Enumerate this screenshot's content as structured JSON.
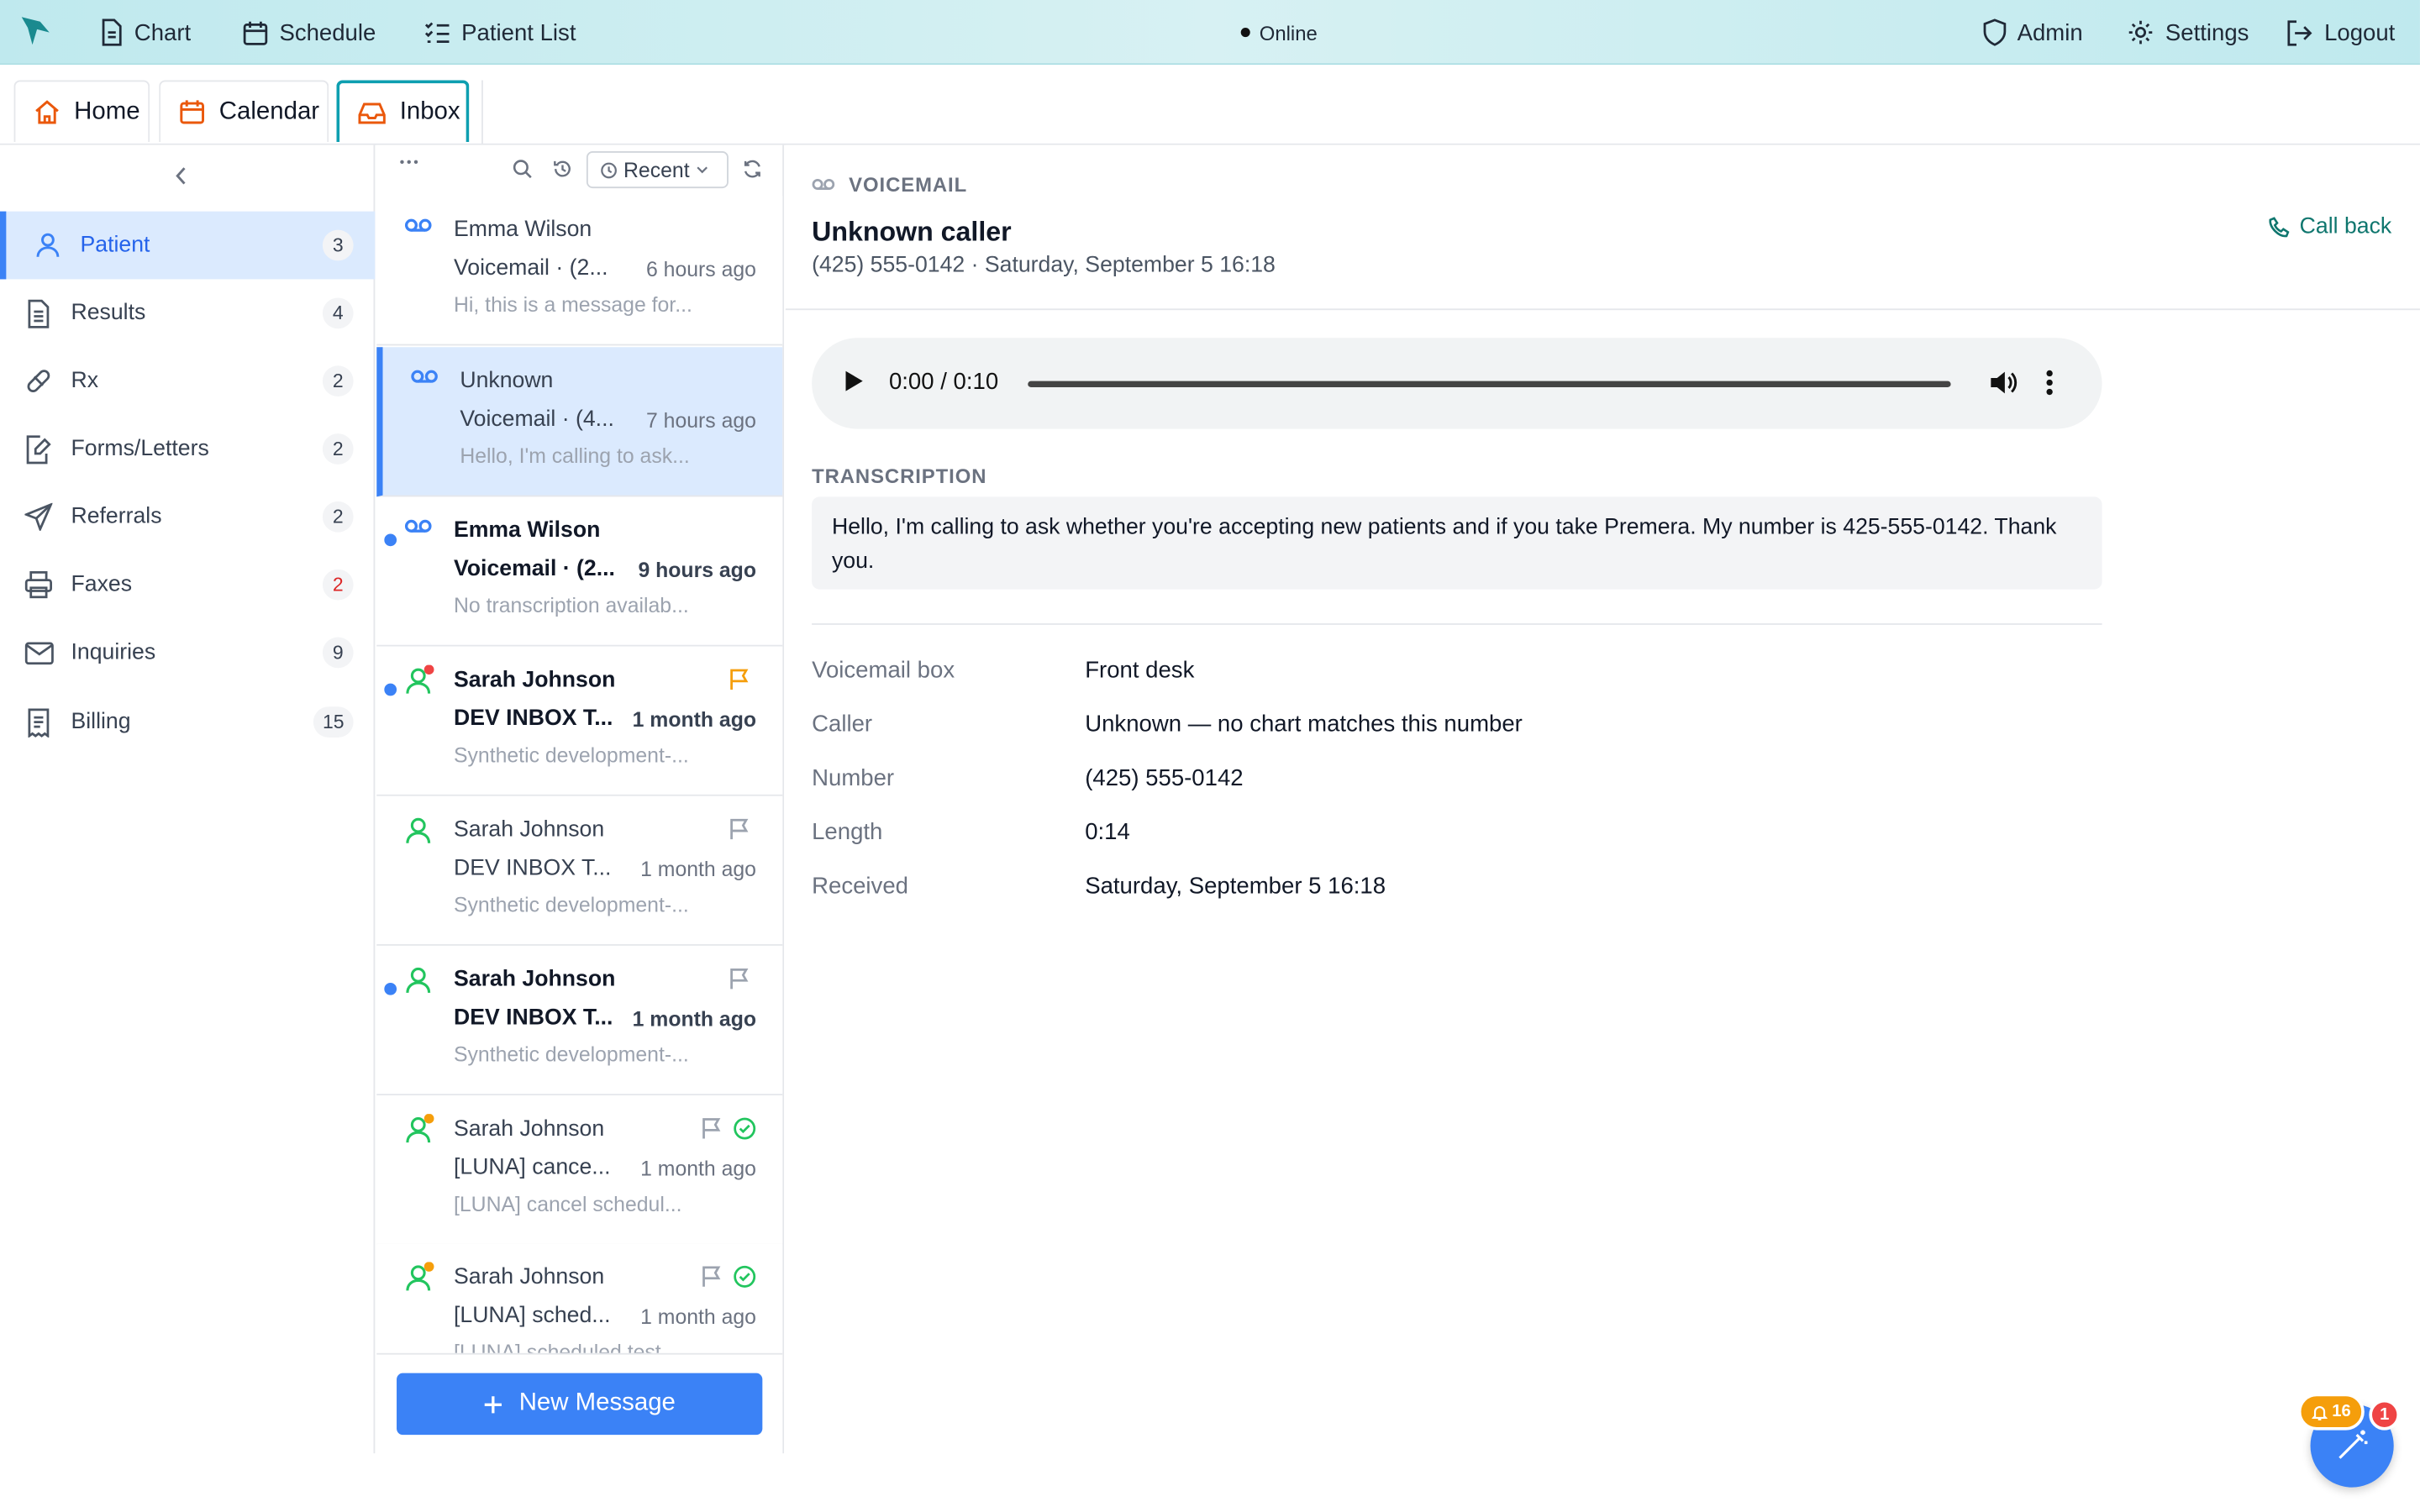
{
  "topnav": {
    "chart": "Chart",
    "schedule": "Schedule",
    "patient_list": "Patient List",
    "status": "Online",
    "admin": "Admin",
    "settings": "Settings",
    "logout": "Logout"
  },
  "tabs": [
    {
      "label": "Home",
      "icon": "home-icon"
    },
    {
      "label": "Calendar",
      "icon": "calendar-icon"
    },
    {
      "label": "Inbox",
      "icon": "inbox-icon",
      "active": true
    }
  ],
  "sidebar": {
    "items": [
      {
        "label": "Patient",
        "count": "3",
        "icon": "user-icon",
        "active": true
      },
      {
        "label": "Results",
        "count": "4",
        "icon": "document-icon"
      },
      {
        "label": "Rx",
        "count": "2",
        "icon": "pill-icon"
      },
      {
        "label": "Forms/Letters",
        "count": "2",
        "icon": "form-icon"
      },
      {
        "label": "Referrals",
        "count": "2",
        "icon": "send-icon"
      },
      {
        "label": "Faxes",
        "count": "2",
        "icon": "printer-icon",
        "alert": true
      },
      {
        "label": "Inquiries",
        "count": "9",
        "icon": "mail-icon"
      },
      {
        "label": "Billing",
        "count": "15",
        "icon": "receipt-icon"
      }
    ]
  },
  "list": {
    "filter_label": "Recent",
    "new_message": "New Message",
    "messages": [
      {
        "name": "Emma Wilson",
        "subject": "Voicemail · (2...",
        "time": "6 hours ago",
        "preview": "Hi, this is a message for...",
        "type": "voicemail",
        "unread": false
      },
      {
        "name": "Unknown",
        "subject": "Voicemail · (4...",
        "time": "7 hours ago",
        "preview": "Hello, I'm calling to ask...",
        "type": "voicemail",
        "unread": false,
        "selected": true
      },
      {
        "name": "Emma Wilson",
        "subject": "Voicemail · (2...",
        "time": "9 hours ago",
        "preview": "No transcription availab...",
        "type": "voicemail",
        "unread": true
      },
      {
        "name": "Sarah Johnson",
        "subject": "DEV INBOX T...",
        "time": "1 month ago",
        "preview": "Synthetic development-...",
        "type": "patient",
        "unread": true,
        "flag": "orange",
        "status_dot": "red"
      },
      {
        "name": "Sarah Johnson",
        "subject": "DEV INBOX T...",
        "time": "1 month ago",
        "preview": "Synthetic development-...",
        "type": "patient",
        "unread": false,
        "flag": "gray"
      },
      {
        "name": "Sarah Johnson",
        "subject": "DEV INBOX T...",
        "time": "1 month ago",
        "preview": "Synthetic development-...",
        "type": "patient",
        "unread": true,
        "flag": "gray"
      },
      {
        "name": "Sarah Johnson",
        "subject": "[LUNA] cance...",
        "time": "1 month ago",
        "preview": "[LUNA] cancel schedul...",
        "type": "patient",
        "unread": false,
        "flag": "gray",
        "done": true,
        "status_dot": "amber"
      },
      {
        "name": "Sarah Johnson",
        "subject": "[LUNA] sched...",
        "time": "1 month ago",
        "preview": "[LUNA] scheduled test...",
        "type": "patient",
        "unread": false,
        "flag": "gray",
        "done": true,
        "status_dot": "amber"
      }
    ]
  },
  "detail": {
    "kind": "VOICEMAIL",
    "caller": "Unknown caller",
    "subtitle": "(425) 555-0142 · Saturday, September 5 16:18",
    "call_back": "Call back",
    "player_time": "0:00 / 0:10",
    "transcription_label": "TRANSCRIPTION",
    "transcription": "Hello, I'm calling to ask whether you're accepting new patients and if you take Premera. My number is 425-555-0142. Thank you.",
    "fields": [
      {
        "key": "Voicemail box",
        "value": "Front desk"
      },
      {
        "key": "Caller",
        "value": "Unknown — no chart matches this number"
      },
      {
        "key": "Number",
        "value": "(425) 555-0142"
      },
      {
        "key": "Length",
        "value": "0:14"
      },
      {
        "key": "Received",
        "value": "Saturday, September 5 16:18"
      }
    ]
  },
  "widget": {
    "notifications": "16",
    "alerts": "1"
  },
  "colors": {
    "accent": "#3b82f6",
    "teal": "#0e9fb0",
    "active_bg": "#dbeafe",
    "alert": "#dc2626"
  }
}
